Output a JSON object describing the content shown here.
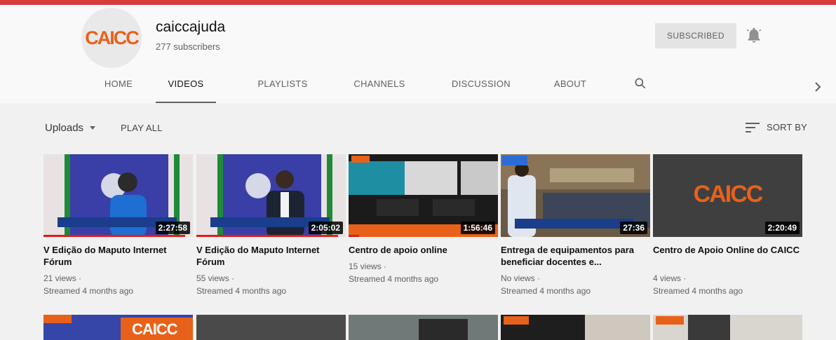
{
  "channel": {
    "logo_text": "CAICC",
    "name": "caiccajuda",
    "subscribers": "277 subscribers",
    "subscribed_label": "SUBSCRIBED"
  },
  "tabs": [
    {
      "label": "HOME"
    },
    {
      "label": "VIDEOS"
    },
    {
      "label": "PLAYLISTS"
    },
    {
      "label": "CHANNELS"
    },
    {
      "label": "DISCUSSION"
    },
    {
      "label": "ABOUT"
    }
  ],
  "filter": {
    "uploads_label": "Uploads",
    "play_all_label": "PLAY ALL",
    "sort_label": "SORT BY"
  },
  "videos": [
    {
      "title": "V Edição do Maputo Internet Fórum",
      "duration": "2:27:58",
      "views": "21 views",
      "age": "Streamed 4 months ago",
      "watched": 0.95
    },
    {
      "title": "V Edição do Maputo Internet Fórum",
      "duration": "2:05:02",
      "views": "55 views",
      "age": "Streamed 4 months ago",
      "watched": 0.95
    },
    {
      "title": "Centro de apoio online",
      "duration": "1:56:46",
      "views": "15 views",
      "age": "Streamed 4 months ago",
      "watched": 0.07
    },
    {
      "title": "Entrega de equipamentos para beneficiar docentes e...",
      "duration": "27:36",
      "views": "No views",
      "age": "Streamed 4 months ago",
      "watched": 0
    },
    {
      "title": "Centro de Apoio Online do CAICC",
      "duration": "2:20:49",
      "views": "4 views",
      "age": "Streamed 4 months ago",
      "watched": 0
    }
  ],
  "colors": {
    "brand_orange": "#e8611a",
    "accent_red": "#d63a3a"
  }
}
